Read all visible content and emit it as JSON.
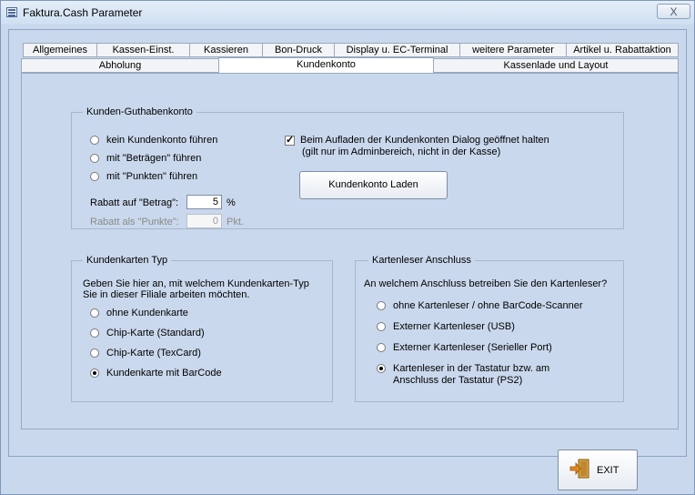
{
  "window": {
    "title": "Faktura.Cash Parameter",
    "close_label": "X"
  },
  "tabs_row1": [
    "Allgemeines",
    "Kassen-Einst.",
    "Kassieren",
    "Bon-Druck",
    "Display u. EC-Terminal",
    "weitere Parameter",
    "Artikel u. Rabattaktion"
  ],
  "tabs_row2": [
    "Abholung",
    "Kundenkonto",
    "Kassenlade und Layout"
  ],
  "active_tab": "Kundenkonto",
  "guthaben": {
    "title": "Kunden-Guthabenkonto",
    "options": [
      {
        "label": "kein Kundenkonto führen",
        "checked": false
      },
      {
        "label": "mit \"Beträgen\" führen",
        "checked": false
      },
      {
        "label": "mit \"Punkten\" führen",
        "checked": false
      }
    ],
    "rabatt_betrag": {
      "label": "Rabatt auf \"Betrag\":",
      "value": "5",
      "unit": "%"
    },
    "rabatt_punkte": {
      "label": "Rabatt als \"Punkte\":",
      "value": "0",
      "unit": "Pkt."
    },
    "checkbox": {
      "checked": true,
      "line1": "Beim Aufladen der Kundenkonten Dialog geöffnet halten",
      "line2": "(gilt nur im Adminbereich, nicht in der Kasse)"
    },
    "button": "Kundenkonto Laden"
  },
  "kartentyp": {
    "title": "Kundenkarten Typ",
    "desc1": "Geben Sie hier an, mit welchem Kundenkarten-Typ",
    "desc2": "Sie in dieser Filiale arbeiten möchten.",
    "options": [
      {
        "label": "ohne Kundenkarte",
        "checked": false
      },
      {
        "label": "Chip-Karte (Standard)",
        "checked": false
      },
      {
        "label": "Chip-Karte (TexCard)",
        "checked": false
      },
      {
        "label": "Kundenkarte mit BarCode",
        "checked": true
      }
    ]
  },
  "kartenleser": {
    "title": "Kartenleser Anschluss",
    "desc": "An welchem Anschluss betreiben Sie den Kartenleser?",
    "options": [
      {
        "label": "ohne Kartenleser / ohne BarCode-Scanner",
        "checked": false
      },
      {
        "label": "Externer Kartenleser (USB)",
        "checked": false
      },
      {
        "label": "Externer Kartenleser (Serieller Port)",
        "checked": false
      },
      {
        "label": "Kartenleser in der Tastatur bzw. am",
        "label2": "Anschluss der Tastatur (PS2)",
        "checked": true
      }
    ]
  },
  "exit_label": "EXIT",
  "icons": {
    "app": "form-icon",
    "exit": "exit-door-icon"
  }
}
